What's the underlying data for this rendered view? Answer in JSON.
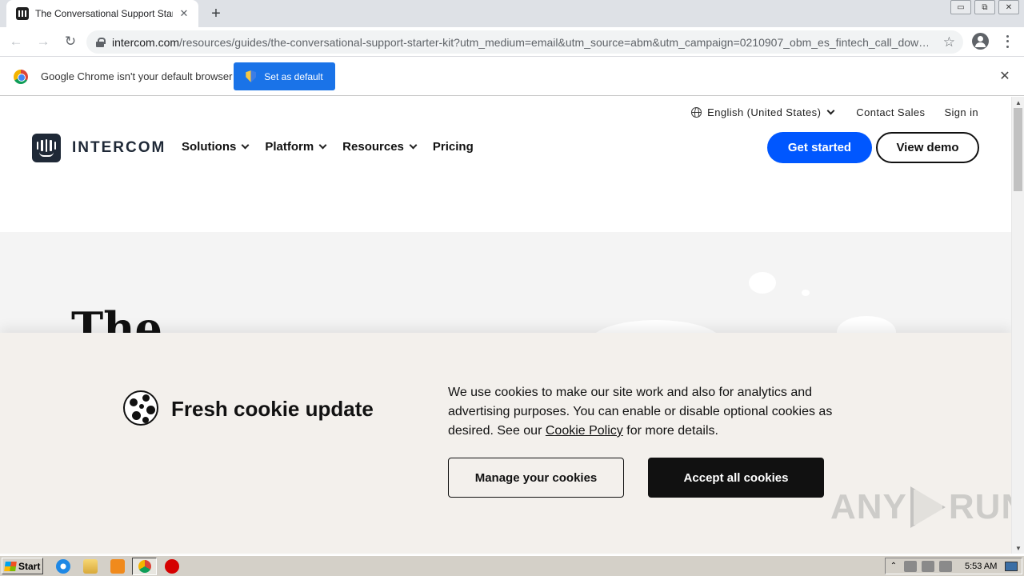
{
  "browser": {
    "tab_title": "The Conversational Support Starter",
    "tab_close": "✕",
    "new_tab": "+",
    "url_host": "intercom.com",
    "url_path": "/resources/guides/the-conversational-support-starter-kit?utm_medium=email&utm_source=abm&utm_campaign=0210907_obm_es_fintech_call_dow…",
    "back": "←",
    "forward": "→",
    "reload": "↻",
    "star": "☆",
    "window_controls": [
      "▭",
      "⧉",
      "✕"
    ]
  },
  "infobar": {
    "message": "Google Chrome isn't your default browser",
    "button": "Set as default",
    "close": "✕"
  },
  "site": {
    "language": "English (United States)",
    "contact": "Contact Sales",
    "sign_in": "Sign in",
    "logo_text": "INTERCOM",
    "nav": [
      {
        "label": "Solutions",
        "has_menu": true
      },
      {
        "label": "Platform",
        "has_menu": true
      },
      {
        "label": "Resources",
        "has_menu": true
      },
      {
        "label": "Pricing",
        "has_menu": false
      }
    ],
    "cta_primary": "Get started",
    "cta_secondary": "View demo",
    "hero_title": "The"
  },
  "cookie_banner": {
    "title": "Fresh cookie update",
    "text_before_link": "We use cookies to make our site work and also for analytics and advertising purposes. You can enable or disable optional cookies as desired. See our ",
    "link_text": "Cookie Policy",
    "text_after_link": " for more details.",
    "manage_button": "Manage your cookies",
    "accept_button": "Accept all cookies"
  },
  "watermark": {
    "left": "ANY",
    "right": "RUN"
  },
  "taskbar": {
    "start_label": "Start",
    "clock": "5:53 AM",
    "tray_arrow": "⌃"
  },
  "colors": {
    "accent_blue": "#0057ff",
    "chrome_button": "#1a73e8",
    "cookie_bg": "#f3f0ec",
    "hero_bg": "#f4f4f4",
    "dark": "#111111"
  }
}
